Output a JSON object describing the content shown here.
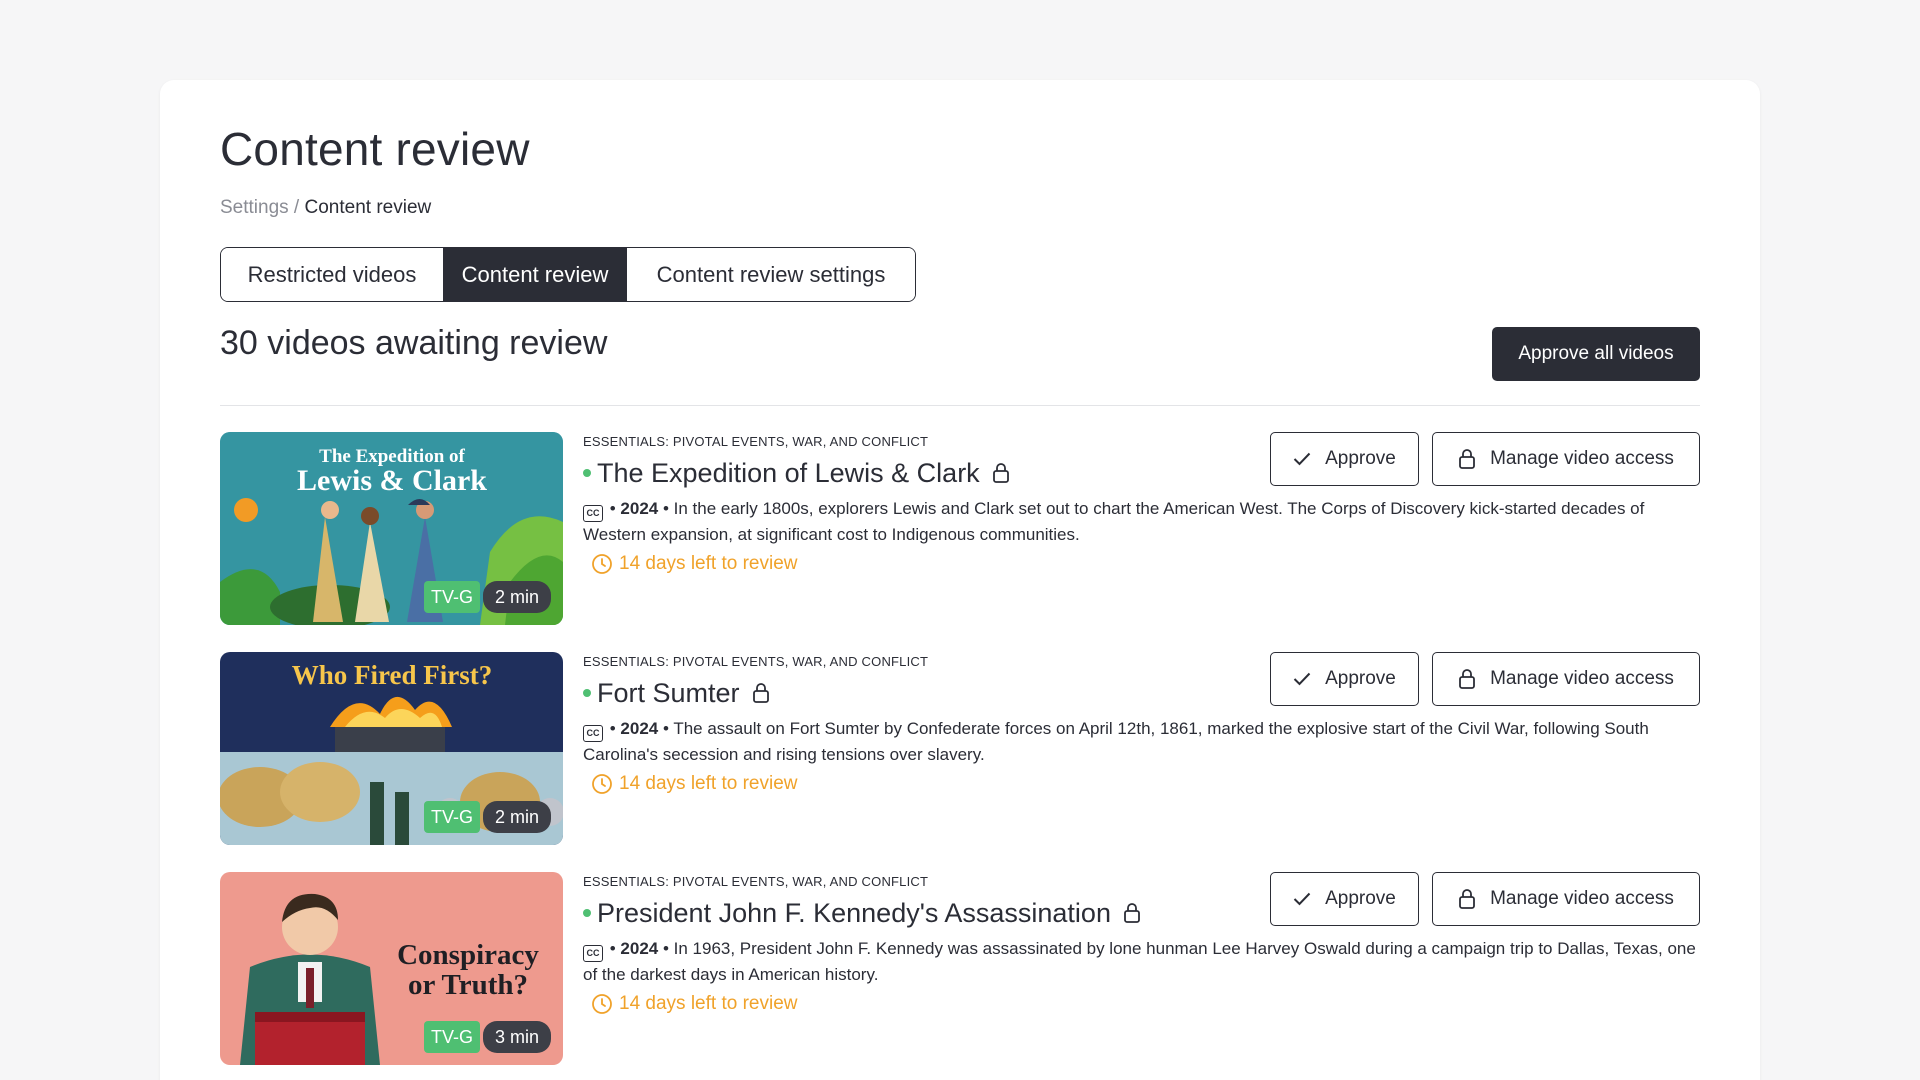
{
  "page": {
    "title": "Content review",
    "breadcrumb": {
      "parent": "Settings",
      "separator": " / ",
      "current": "Content review"
    },
    "tabs": [
      {
        "label": "Restricted videos",
        "active": false
      },
      {
        "label": "Content review",
        "active": true
      },
      {
        "label": "Content review settings",
        "active": false
      }
    ],
    "count_heading": "30 videos awaiting review",
    "approve_all_label": "Approve all videos"
  },
  "colors": {
    "primary_dark": "#2b2d36",
    "status_green": "#4fbf72",
    "warning_orange": "#f0a22a"
  },
  "actions": {
    "approve_label": "Approve",
    "approve_icon": "check-icon",
    "manage_label": "Manage video access",
    "manage_icon": "lock-icon"
  },
  "videos": [
    {
      "collection": "ESSENTIALS: PIVOTAL EVENTS, WAR, AND CONFLICT",
      "title": "The Expedition of Lewis & Clark",
      "year": "2024",
      "description": "In the early 1800s, explorers Lewis and Clark set out to chart the American West. The Corps of Discovery kick-started decades of Western expansion, at significant cost to Indigenous communities.",
      "deadline": "14 days left to review",
      "rating": "TV-G",
      "duration": "2 min",
      "thumb_line1": "The Expedition of",
      "thumb_line2": "Lewis & Clark"
    },
    {
      "collection": "ESSENTIALS: PIVOTAL EVENTS, WAR, AND CONFLICT",
      "title": "Fort Sumter",
      "year": "2024",
      "description": "The assault on Fort Sumter by Confederate forces on April 12th, 1861, marked the explosive start of the Civil War, following South Carolina's secession and rising tensions over slavery.",
      "deadline": "14 days left to review",
      "rating": "TV-G",
      "duration": "2 min",
      "thumb_line1": "Who Fired First?"
    },
    {
      "collection": "ESSENTIALS: PIVOTAL EVENTS, WAR, AND CONFLICT",
      "title": "President John F. Kennedy's Assassination",
      "year": "2024",
      "description": "In 1963, President John F. Kennedy was assassinated by lone hunman Lee Harvey Oswald during a campaign trip to Dallas, Texas, one of the darkest days in American history.",
      "deadline": "14 days left to review",
      "rating": "TV-G",
      "duration": "3 min",
      "thumb_line1": "Conspiracy",
      "thumb_line2": "or Truth?"
    }
  ]
}
